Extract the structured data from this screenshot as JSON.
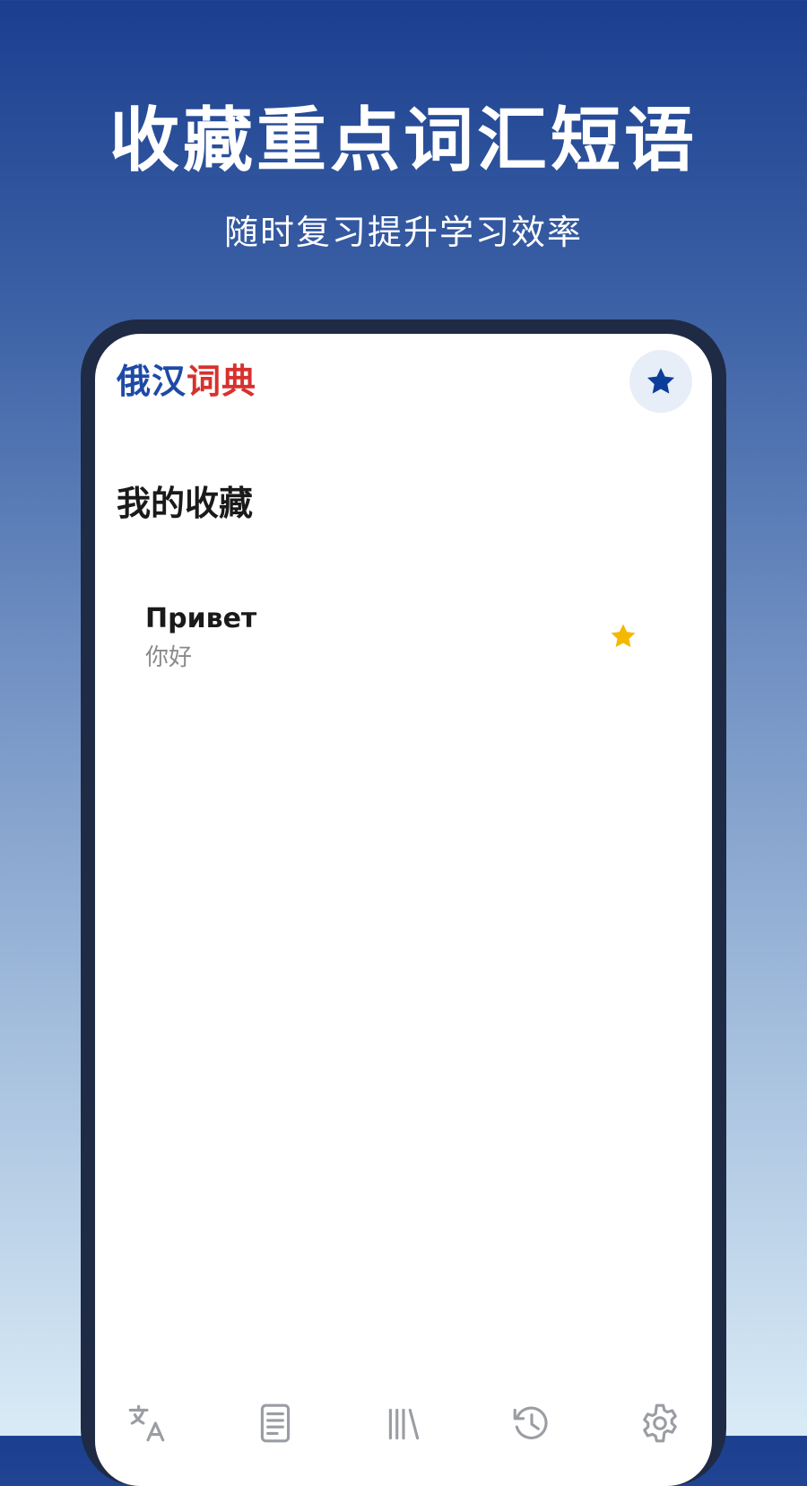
{
  "promo": {
    "headline": "收藏重点词汇短语",
    "subheadline": "随时复习提升学习效率"
  },
  "app": {
    "logo_part1": "俄汉",
    "logo_part2": "词典",
    "favorites_icon": "star-icon"
  },
  "favorites": {
    "title": "我的收藏",
    "items": [
      {
        "word": "Привет",
        "meaning": "你好"
      }
    ]
  },
  "nav": {
    "items": [
      {
        "icon": "translate-icon"
      },
      {
        "icon": "document-icon"
      },
      {
        "icon": "library-icon"
      },
      {
        "icon": "history-icon"
      },
      {
        "icon": "settings-icon"
      }
    ]
  },
  "colors": {
    "brand_blue": "#1e4aa6",
    "brand_red": "#d7312e",
    "star_active": "#f5b800",
    "icon_gray": "#9a9da3"
  }
}
